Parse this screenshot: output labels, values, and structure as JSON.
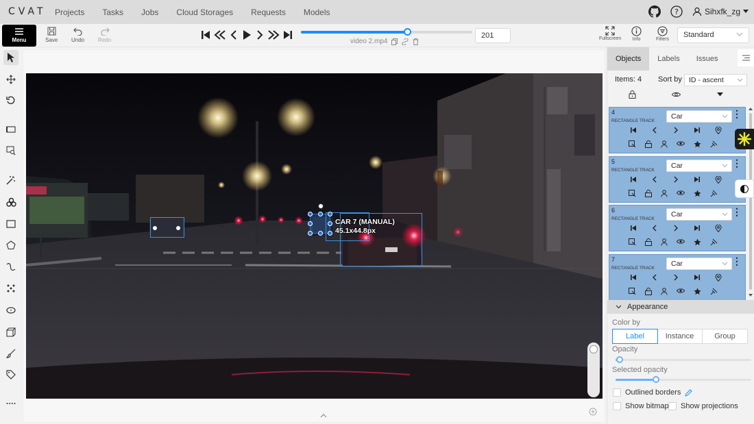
{
  "nav": {
    "logo": "CVAT",
    "links": [
      "Projects",
      "Tasks",
      "Jobs",
      "Cloud Storages",
      "Requests",
      "Models"
    ],
    "username": "Sihxfk_zg"
  },
  "toolbar": {
    "menu_label": "Menu",
    "save_label": "Save",
    "undo_label": "Undo",
    "redo_label": "Redo",
    "filename": "video 2.mp4",
    "frame_number": "201",
    "frame_progress": 0.62,
    "fullscreen_label": "Fullscreen",
    "info_label": "Info",
    "filters_label": "Filters",
    "workspace_value": "Standard"
  },
  "canvas": {
    "active_label": "CAR 7 (MANUAL)",
    "active_size": "45.1x44.8px"
  },
  "sidebar": {
    "tabs": [
      "Objects",
      "Labels",
      "Issues"
    ],
    "active_tab": "Objects",
    "items_count_label": "Items: 4",
    "sort_label": "Sort by",
    "sort_value": "ID - ascent",
    "objects": [
      {
        "id": "4",
        "type": "RECTANGLE TRACK",
        "label": "Car"
      },
      {
        "id": "5",
        "type": "RECTANGLE TRACK",
        "label": "Car"
      },
      {
        "id": "6",
        "type": "RECTANGLE TRACK",
        "label": "Car"
      },
      {
        "id": "7",
        "type": "RECTANGLE TRACK",
        "label": "Car"
      }
    ],
    "appearance": {
      "title": "Appearance",
      "color_by_label": "Color by",
      "color_by_options": [
        "Label",
        "Instance",
        "Group"
      ],
      "color_by_selected": "Label",
      "opacity_label": "Opacity",
      "opacity_value": 0.03,
      "selected_opacity_label": "Selected opacity",
      "selected_opacity_value": 0.3,
      "outlined_borders_label": "Outlined borders",
      "show_bitmap_label": "Show bitmap",
      "show_projections_label": "Show projections"
    }
  },
  "colors": {
    "accent": "#1890ff",
    "card_bg": "#8db4db",
    "bbox": "#3f8fe0"
  }
}
